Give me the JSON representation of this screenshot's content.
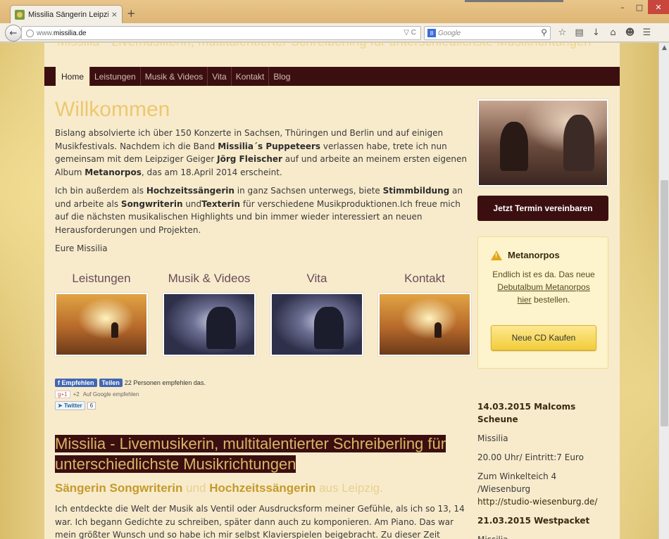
{
  "browser": {
    "tab_title": "Missilia Sängerin Leipzig - ...",
    "tab_close": "×",
    "new_tab": "+",
    "url_prefix": "www.",
    "url_domain": "missilia.de",
    "url_tools": "▽ C",
    "search_engine_badge": "8",
    "search_placeholder": "Google",
    "toolbar_icons": [
      "star-icon",
      "bookmarks-icon",
      "download-icon",
      "home-icon",
      "chat-icon",
      "menu-icon"
    ],
    "window_controls": [
      "–",
      "□",
      "✕"
    ]
  },
  "site": {
    "header_ghost": "Missilia - Livemusikerin, multitalentierter Schreiberling für unterschiedlichste Musikrichtungen",
    "menu": [
      "Home",
      "Leistungen",
      "Musik & Videos",
      "Vita",
      "Kontakt",
      "Blog"
    ],
    "menu_active": "Home"
  },
  "main": {
    "title": "Willkommen",
    "intro": {
      "t1": "Bislang absolvierte ich über 150 Konzerte in Sachsen, Thüringen und Berlin und auf einigen Musikfestivals. Nachdem ich die Band ",
      "b1": "Missilia´s Puppeteers",
      "t2": " verlassen habe, trete ich nun gemeinsam mit dem Leipziger Geiger ",
      "b2": "Jörg Fleischer",
      "t3": " auf und arbeite an meinem ersten eigenen Album ",
      "b3": "Metanorpos",
      "t4": ", das am 18.April 2014 erscheint."
    },
    "para2": {
      "t1": "Ich bin außerdem als ",
      "b1": "Hochzeitssängerin",
      "t2": " in ganz Sachsen unterwegs, biete ",
      "b2": "Stimmbildung",
      "t3": " an und arbeite als ",
      "b3": "Songwriterin",
      "t4": " und",
      "b4": "Texterin",
      "t5": " für verschiedene Musikproduktionen.Ich freue mich auf die nächsten musikalischen Highlights und bin immer wieder interessiert an neuen Herausforderungen und Projekten."
    },
    "signature": "Eure Missilia",
    "tiles": [
      {
        "label": "Leistungen"
      },
      {
        "label": "Musik & Videos"
      },
      {
        "label": "Vita"
      },
      {
        "label": "Kontakt"
      }
    ],
    "social": {
      "fb_like": "Empfehlen",
      "fb_share": "Teilen",
      "fb_text": "22 Personen empfehlen das.",
      "gplus": "g+1",
      "gplus_count": "+2",
      "gplus_text": "Auf Google empfehlen",
      "twitter": "Twitter",
      "twitter_count": "6"
    },
    "section_title": "Missilia - Livemusikerin, multitalentierter Schreiberling für unterschiedlichste Musikrichtungen",
    "subtitle": {
      "b1": "Sängerin",
      "b2": "Songwriterin",
      "t1": " und ",
      "b3": "Hochzeitssängerin",
      "t2": " aus Leipzig."
    },
    "story": "Ich entdeckte die Welt der Musik als Ventil oder Ausdrucksform meiner Gefühle, als ich so 13, 14 war. Ich begann Gedichte zu schreiben, später dann auch zu komponieren. Am Piano. Das war mein größter Wunsch und so habe ich mir selbst Klavierspielen beigebracht. Zu dieser Zeit"
  },
  "sidebar": {
    "cta": "Jetzt Termin vereinbaren",
    "notice_title": "Metanorpos",
    "notice": {
      "t1": "Endlich ist es da. Das neue ",
      "link1": "Debutalbum Metanorpos",
      "link2": "hier",
      "t2": " bestellen."
    },
    "buy_button": "Neue CD Kaufen",
    "events": [
      {
        "date": "14.03.2015 Malcoms Scheune",
        "lines": [
          "Missilia",
          "20.00 Uhr/ Eintritt:7 Euro",
          "Zum Winkelteich 4 /Wiesenburg"
        ],
        "link": "http://studio-wiesenburg.de/"
      },
      {
        "date": "21.03.2015 Westpacket",
        "lines": [
          "Missilia"
        ],
        "link": ""
      }
    ]
  }
}
